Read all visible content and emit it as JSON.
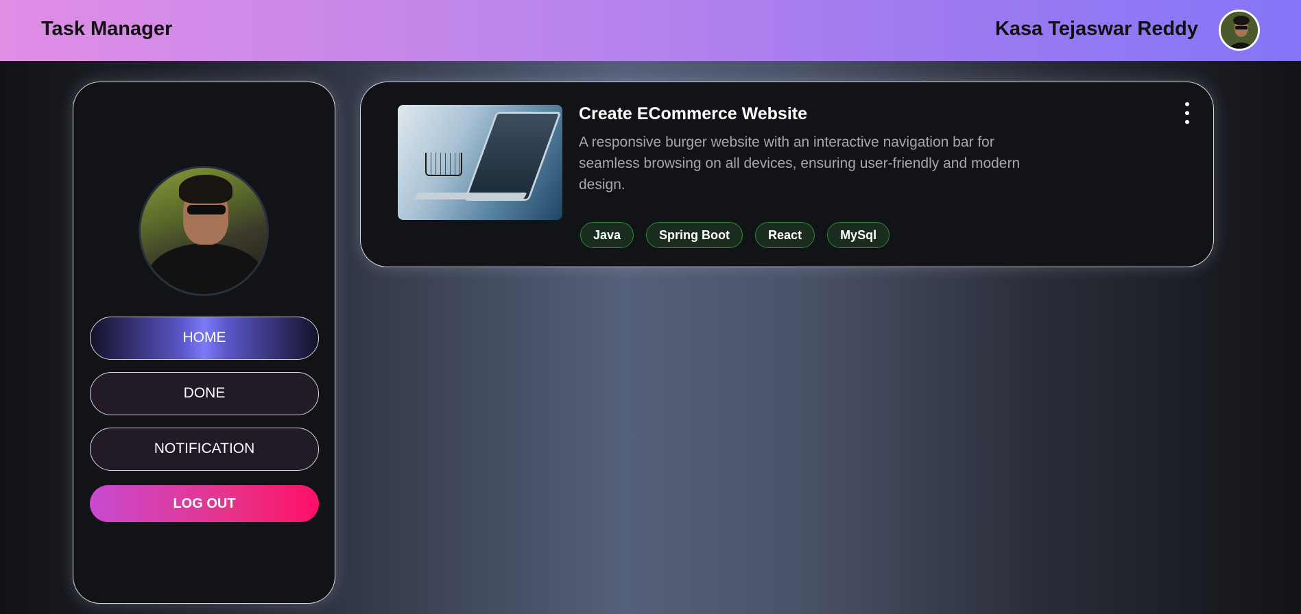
{
  "header": {
    "app_title": "Task Manager",
    "user_name": "Kasa Tejaswar Reddy"
  },
  "sidebar": {
    "items": [
      {
        "label": "HOME"
      },
      {
        "label": "DONE"
      },
      {
        "label": "NOTIFICATION"
      },
      {
        "label": "LOG OUT"
      }
    ]
  },
  "task": {
    "title": "Create ECommerce Website",
    "description": "A responsive burger website with an interactive navigation bar for seamless browsing on all devices, ensuring user-friendly and modern design.",
    "tags": [
      "Java",
      "Spring Boot",
      "React",
      "MySql"
    ]
  },
  "colors": {
    "header_start": "#e08de6",
    "header_end": "#8475f7",
    "logout_start": "#c84ad0",
    "logout_end": "#ff0f66",
    "tag_border": "#2c8a38",
    "tag_bg": "#1a2c1e"
  },
  "icons": {
    "menu": "more-vertical-icon",
    "avatar": "user-avatar"
  }
}
